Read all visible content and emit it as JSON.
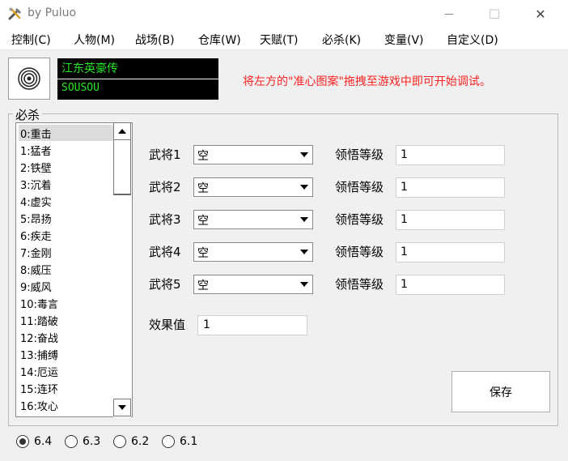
{
  "window": {
    "title": "by Puluo",
    "minimize_glyph": "—",
    "maximize_glyph": "☐",
    "close_glyph": "✕"
  },
  "menu": [
    {
      "label": "控制(C)"
    },
    {
      "label": "人物(M)"
    },
    {
      "label": "战场(B)"
    },
    {
      "label": "仓库(W)"
    },
    {
      "label": "天赋(T)"
    },
    {
      "label": "必杀(K)"
    },
    {
      "label": "变量(V)"
    },
    {
      "label": "自定义(D)"
    }
  ],
  "target": {
    "icon": "crosshair-target-icon"
  },
  "game": {
    "title": "江东英豪传",
    "code": "SOUSOU"
  },
  "hint": "将左方的\"准心图案\"拖拽至游戏中即可开始调试。",
  "group": {
    "legend": "必杀"
  },
  "skills": [
    "0:重击",
    "1:猛者",
    "2:铁壁",
    "3:沉着",
    "4:虚实",
    "5:昂扬",
    "6:疾走",
    "7:金刚",
    "8:威压",
    "9:威风",
    "10:毒言",
    "11:踏破",
    "12:奋战",
    "13:捕缚",
    "14:厄运",
    "15:连环",
    "16:攻心"
  ],
  "selected_skill_index": 0,
  "generals": [
    {
      "label": "武将1",
      "value": "空",
      "level_label": "领悟等级",
      "level": "1"
    },
    {
      "label": "武将2",
      "value": "空",
      "level_label": "领悟等级",
      "level": "1"
    },
    {
      "label": "武将3",
      "value": "空",
      "level_label": "领悟等级",
      "level": "1"
    },
    {
      "label": "武将4",
      "value": "空",
      "level_label": "领悟等级",
      "level": "1"
    },
    {
      "label": "武将5",
      "value": "空",
      "level_label": "领悟等级",
      "level": "1"
    }
  ],
  "effect": {
    "label": "效果值",
    "value": "1"
  },
  "save_label": "保存",
  "versions": [
    {
      "label": "6.4",
      "checked": true
    },
    {
      "label": "6.3",
      "checked": false
    },
    {
      "label": "6.2",
      "checked": false
    },
    {
      "label": "6.1",
      "checked": false
    }
  ],
  "colors": {
    "accent_text": "#26e626",
    "hint": "#ff2222",
    "selection": "#dcdcdc"
  }
}
